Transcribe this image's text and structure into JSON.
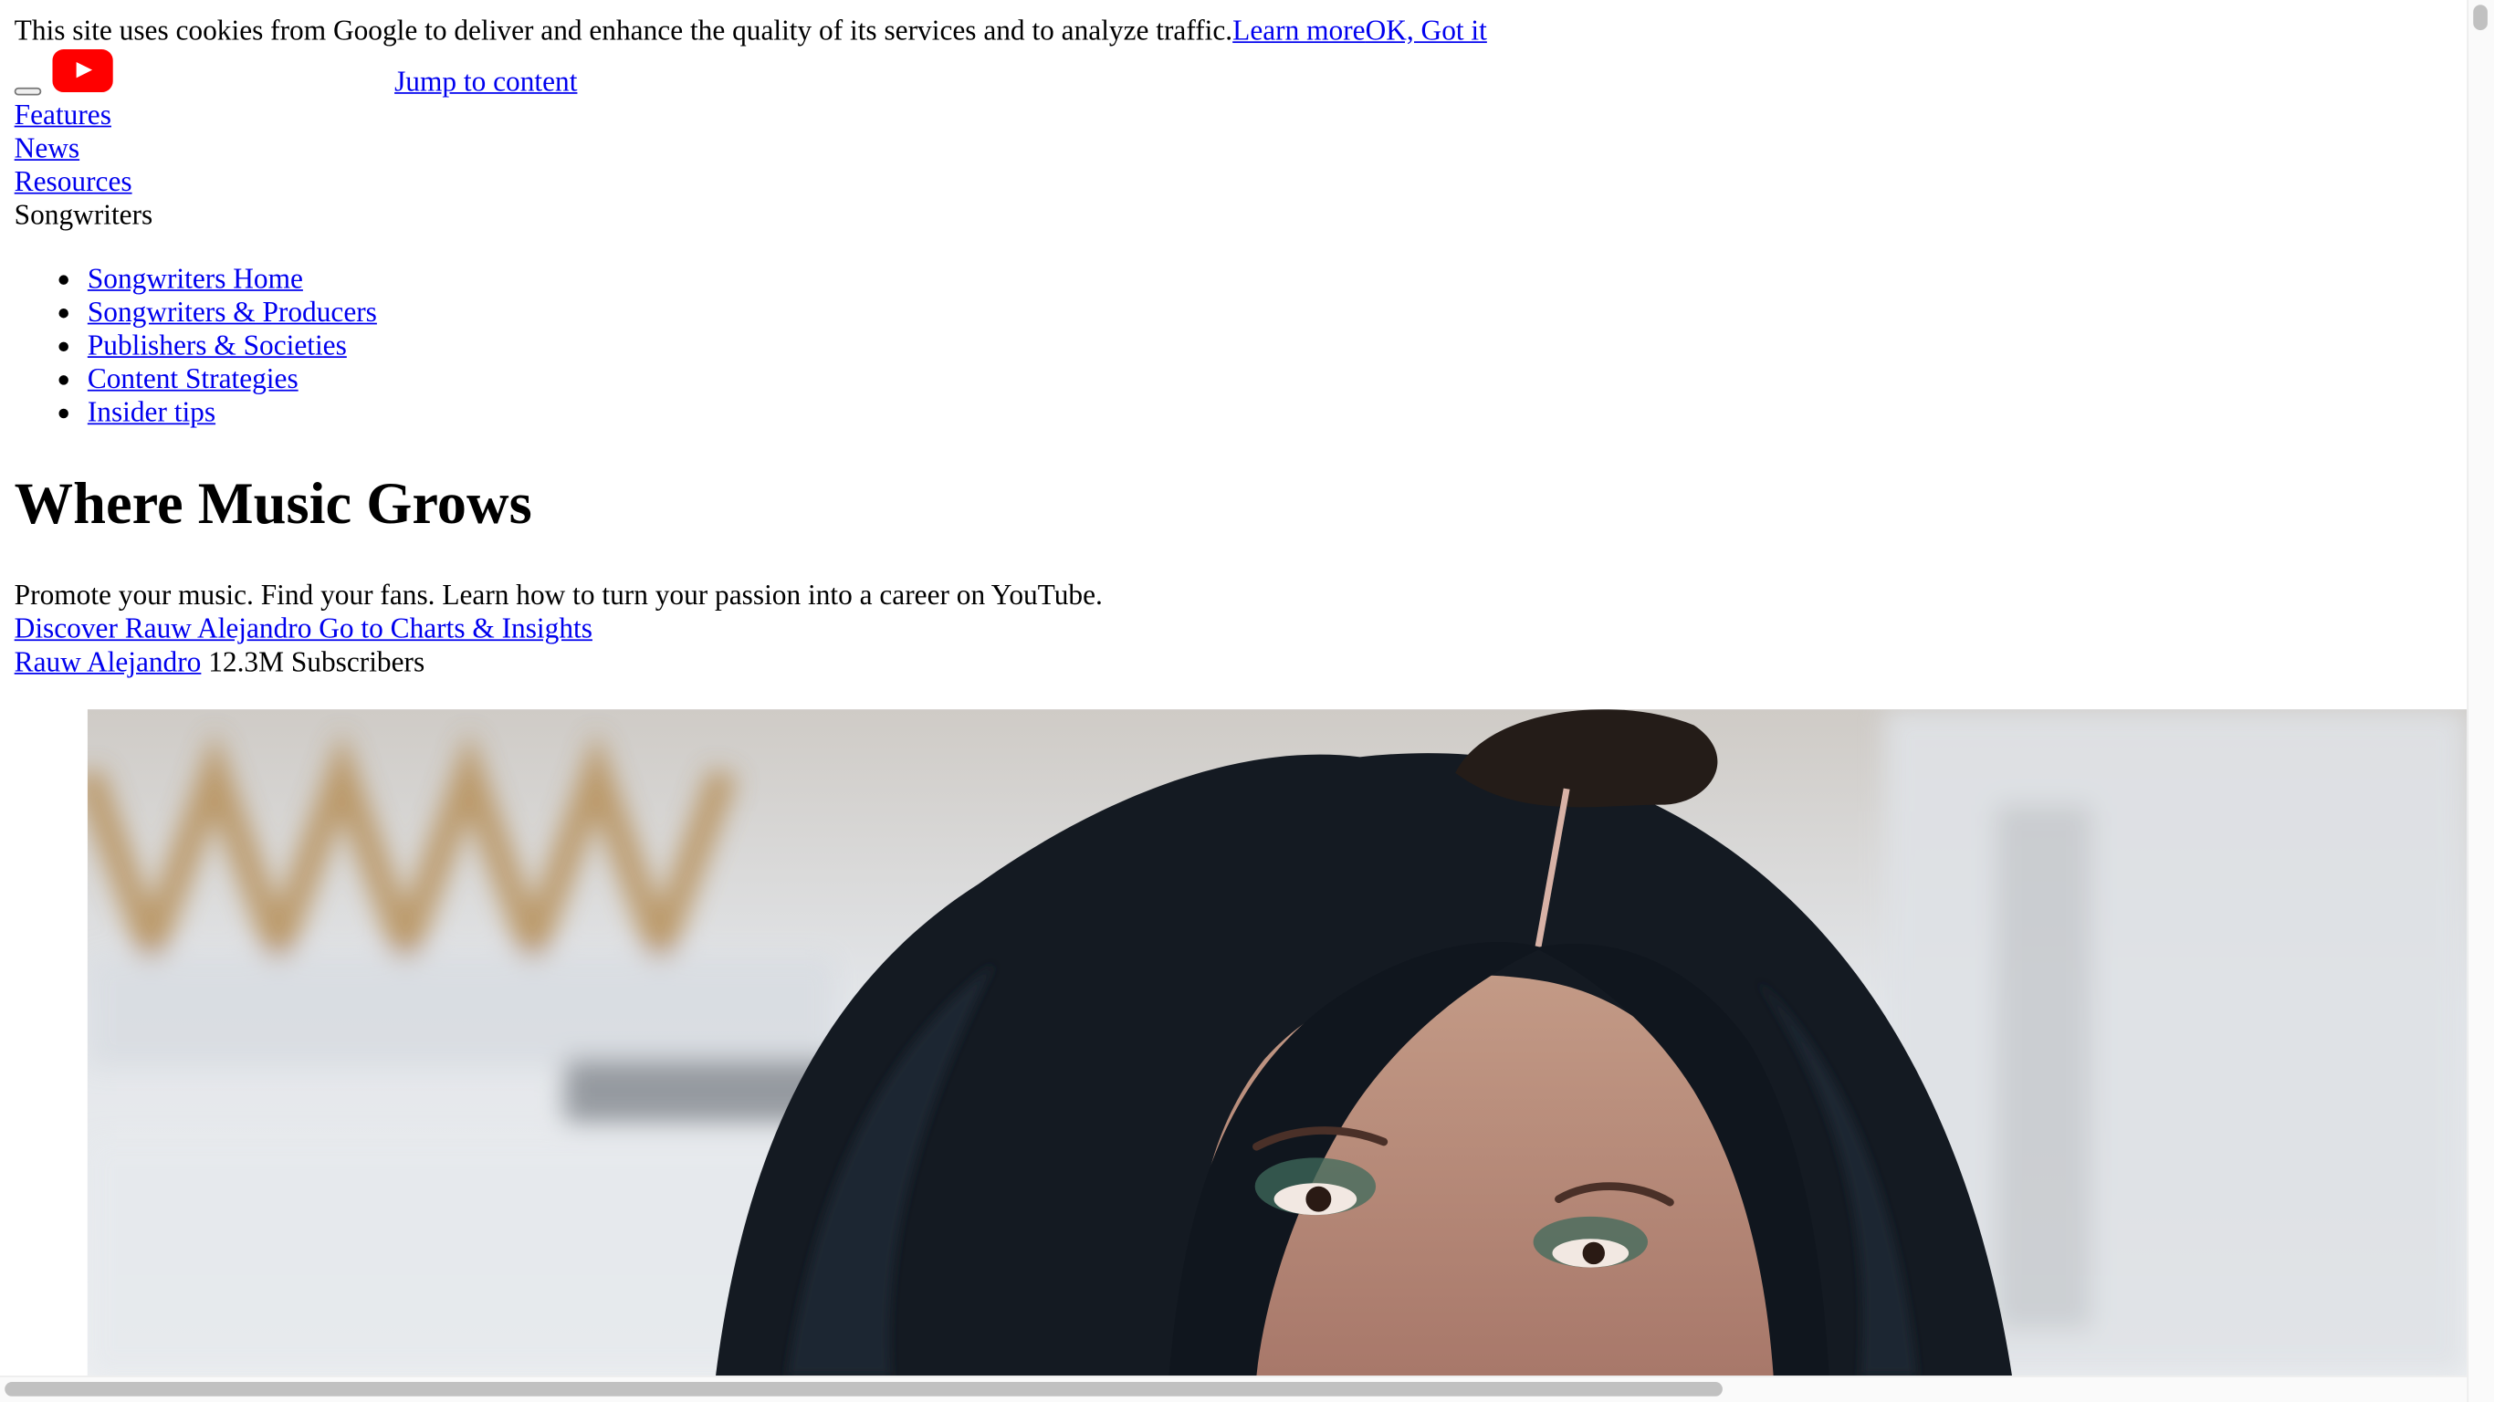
{
  "cookie_banner": {
    "message": "This site uses cookies from Google to deliver and enhance the quality of its services and to analyze traffic.",
    "learn_more": "Learn more",
    "ok": "OK, Got it"
  },
  "header": {
    "logo_icon": "youtube-play-icon",
    "brand_color": "#ff0000",
    "jump_link": "Jump to content"
  },
  "main_nav": {
    "items": [
      "Features",
      "News",
      "Resources"
    ],
    "current": "Songwriters"
  },
  "sub_nav": {
    "items": [
      "Songwriters Home",
      "Songwriters & Producers",
      "Publishers & Societies",
      "Content Strategies",
      "Insider tips"
    ]
  },
  "hero": {
    "title": "Where Music Grows",
    "subtitle": "Promote your music. Find your fans. Learn how to turn your passion into a career on YouTube.",
    "cta": "Discover Rauw Alejandro Go to Charts & Insights"
  },
  "artist": {
    "name": "Rauw Alejandro",
    "subscribers": "12.3M Subscribers"
  },
  "colors": {
    "link": "#0000ee",
    "text": "#000000"
  }
}
